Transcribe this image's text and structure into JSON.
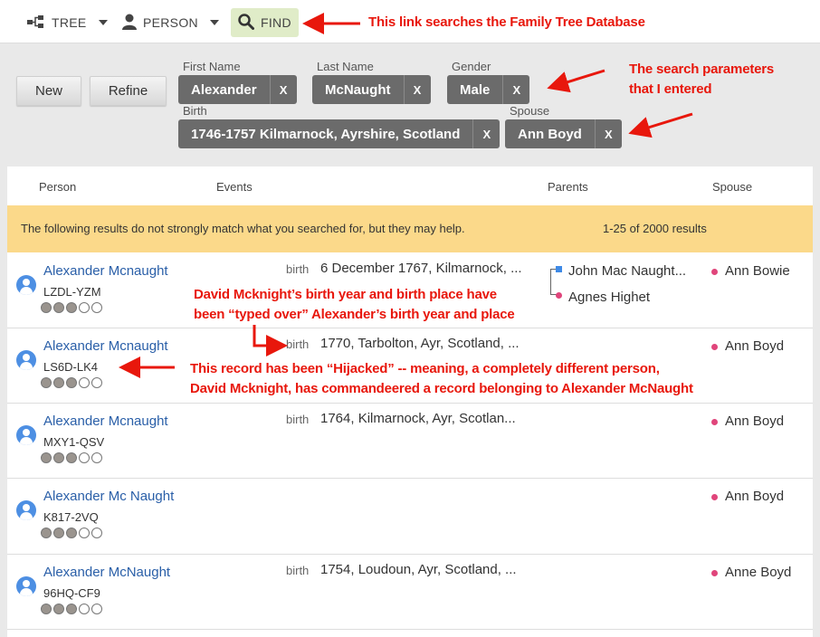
{
  "nav": {
    "tree_label": "TREE",
    "person_label": "PERSON",
    "find_label": "FIND",
    "icons": [
      "tree-icon",
      "person-icon",
      "search-icon"
    ]
  },
  "search": {
    "new_label": "New",
    "refine_label": "Refine",
    "params": [
      {
        "label": "First Name",
        "value": "Alexander"
      },
      {
        "label": "Last Name",
        "value": "McNaught"
      },
      {
        "label": "Gender",
        "value": "Male"
      },
      {
        "label": "Birth",
        "value": "1746-1757 Kilmarnock, Ayrshire, Scotland"
      },
      {
        "label": "Spouse",
        "value": "Ann Boyd"
      }
    ],
    "remove_label": "X"
  },
  "results": {
    "columns": [
      "Person",
      "Events",
      "Parents",
      "Spouse"
    ],
    "notice": "The following results do not strongly match what you searched for, but they may help.",
    "count": "1-25 of 2000 results",
    "rows": [
      {
        "name": "Alexander Mcnaught",
        "id": "LZDL-YZM",
        "event_type": "birth",
        "event": "6 December 1767, Kilmarnock, ...",
        "parents": [
          "John Mac Naught...",
          "Agnes Highet"
        ],
        "spouse": "Ann Bowie"
      },
      {
        "name": "Alexander Mcnaught",
        "id": "LS6D-LK4",
        "event_type": "birth",
        "event": "1770, Tarbolton, Ayr, Scotland, ...",
        "parents": [],
        "spouse": "Ann Boyd"
      },
      {
        "name": "Alexander Mcnaught",
        "id": "MXY1-QSV",
        "event_type": "birth",
        "event": "1764, Kilmarnock, Ayr, Scotlan...",
        "parents": [],
        "spouse": "Ann Boyd"
      },
      {
        "name": "Alexander Mc Naught",
        "id": "K817-2VQ",
        "event_type": "",
        "event": "",
        "parents": [],
        "spouse": "Ann Boyd"
      },
      {
        "name": "Alexander McNaught",
        "id": "96HQ-CF9",
        "event_type": "birth",
        "event": "1754, Loudoun, Ayr, Scotland, ...",
        "parents": [],
        "spouse": "Anne Boyd"
      }
    ],
    "score_filled": 3,
    "score_total": 5
  },
  "annotations": {
    "find_note": "This link searches the Family Tree Database",
    "params_note_1": "The search parameters",
    "params_note_2": "that I entered",
    "typed_note_1": "David Mcknight’s birth year and birth place have",
    "typed_note_2": "been “typed over” Alexander’s birth year and place",
    "hijack_note_1": "This record has been “Hijacked” -- meaning, a completely different person,",
    "hijack_note_2": "David Mcknight, has commandeered a record belonging to Alexander McNaught"
  },
  "colors": {
    "annotation": "#e8170c",
    "link": "#2a5fa8",
    "notice": "#fbd98a",
    "chip": "#6b6b6b",
    "find_bg": "#e0ecc8"
  }
}
